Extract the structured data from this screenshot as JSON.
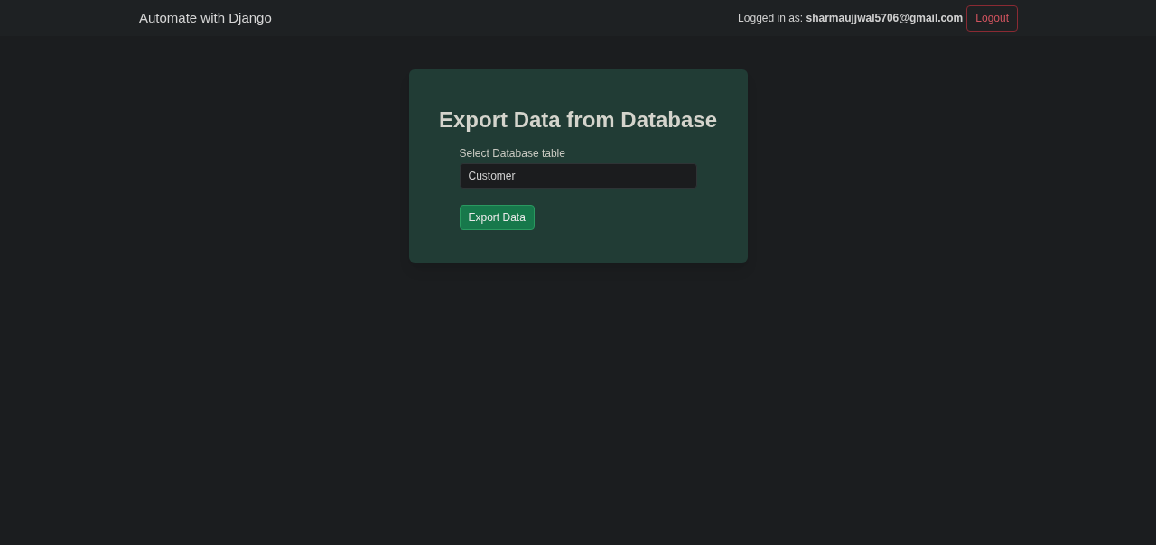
{
  "navbar": {
    "brand": "Automate with Django",
    "user_text": "Logged in as: **sharmaujjwal5706@gmail.com**",
    "logout": "Logout"
  },
  "card": {
    "title": "Export Data from Database",
    "field": {
      "label": "Select Database table",
      "value": "Customer"
    },
    "submit": "Export Data"
  }
}
